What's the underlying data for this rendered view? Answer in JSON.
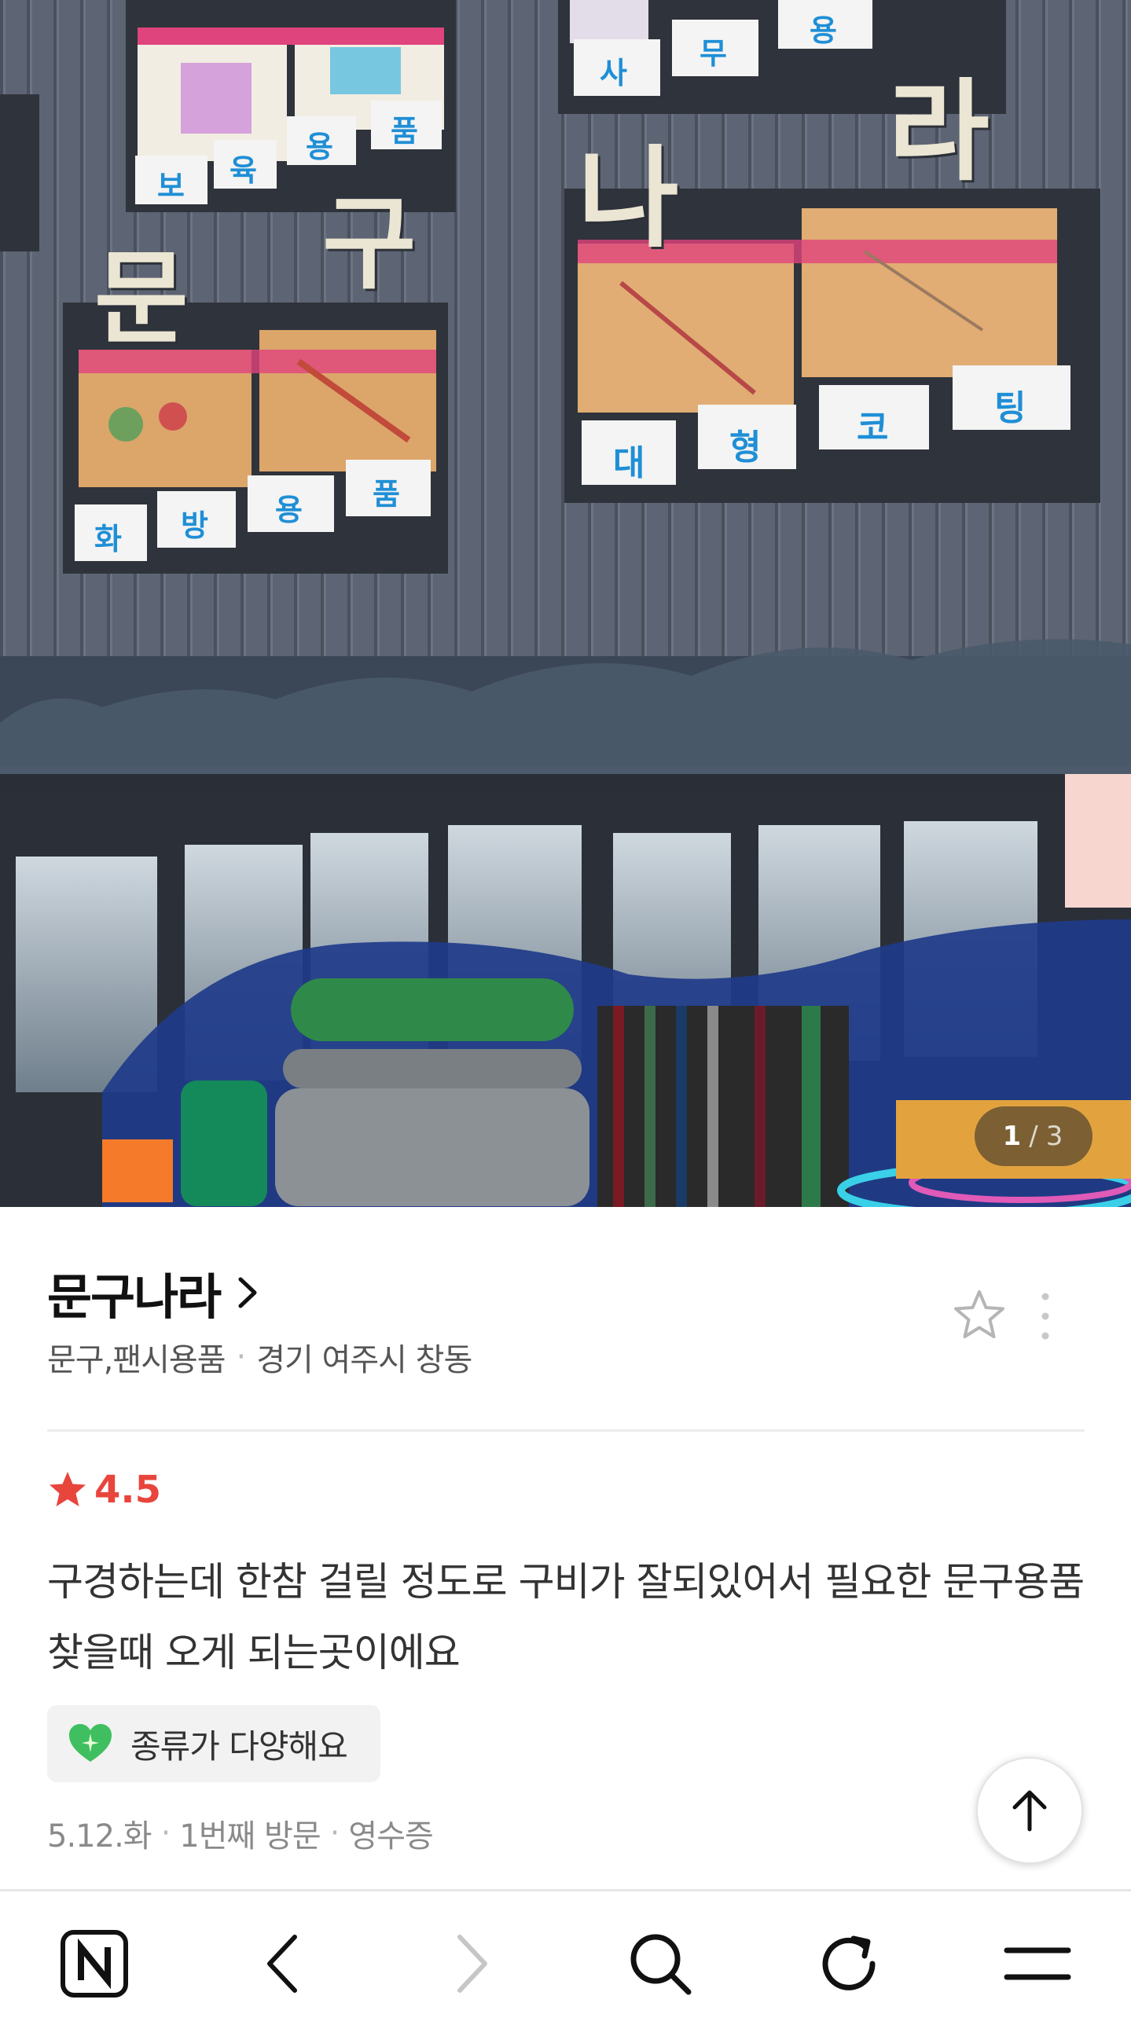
{
  "photo": {
    "current_index": "1",
    "separator": "/",
    "total": "3",
    "signs": {
      "store_name_left": [
        "문",
        "구"
      ],
      "store_name_right": [
        "나",
        "라"
      ],
      "panel_top_left": [
        "보",
        "육",
        "용",
        "품"
      ],
      "panel_top_right": [
        "사",
        "무",
        "용"
      ],
      "panel_mid_left": [
        "화",
        "방",
        "용",
        "품"
      ],
      "panel_mid_right": [
        "대",
        "형",
        "코",
        "팅"
      ]
    }
  },
  "place": {
    "name": "문구나라",
    "category": "문구,팬시용품",
    "location": "경기 여주시 창동"
  },
  "review": {
    "rating": "4.5",
    "text": "구경하는데 한참 걸릴 정도로 구비가 잘되있어서 필요한 문구용품 찾을때 오게 되는곳이에요",
    "keyword": "종류가 다양해요",
    "date": "5.12.화",
    "visit_count": "1번째 방문",
    "proof": "영수증"
  },
  "colors": {
    "rating_red": "#e8453c",
    "chip_bg": "#f2f2f2",
    "heart_green": "#3fbf5f",
    "building_wall": "#5b6270"
  },
  "icons": {
    "chevron": "chevron-right-icon",
    "favorite": "star-outline-icon",
    "more": "more-vertical-icon",
    "rating": "star-filled-icon",
    "keyword": "heart-icon",
    "scroll_top": "arrow-up-icon",
    "nav": [
      "naver-home-icon",
      "back-icon",
      "forward-icon",
      "search-icon",
      "refresh-icon",
      "menu-icon"
    ]
  }
}
